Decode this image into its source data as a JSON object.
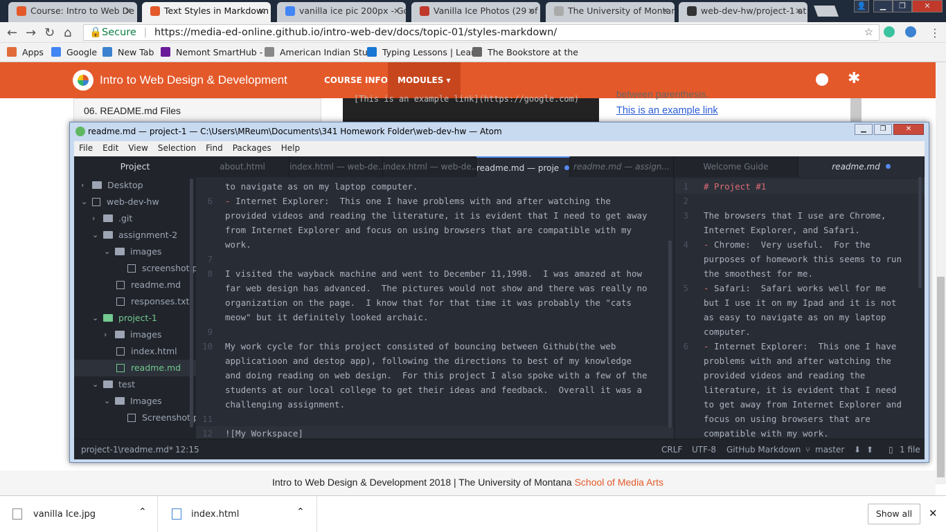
{
  "browser": {
    "tabs": [
      {
        "label": "Course: Intro to Web De",
        "fav": "#e4592a"
      },
      {
        "label": "Text Styles in Markdown",
        "fav": "#e4592a"
      },
      {
        "label": "vanilla ice pic 200px - Go",
        "fav": "#4285f4"
      },
      {
        "label": "Vanilla Ice Photos (29 of",
        "fav": "#c0392b"
      },
      {
        "label": "The University of Montar",
        "fav": "#aaa"
      },
      {
        "label": "web-dev-hw/project-1 at",
        "fav": "#333"
      }
    ],
    "secure": "Secure",
    "url": "https://media-ed-online.github.io/intro-web-dev/docs/topic-01/styles-markdown/",
    "bookmarks": [
      "Apps",
      "Google",
      "New Tab",
      "Nemont SmartHub -",
      "American Indian Stuc",
      "Typing Lessons | Lear",
      "The Bookstore at the"
    ]
  },
  "site": {
    "title": "Intro to Web Design & Development",
    "nav": [
      "COURSE INFO",
      "MODULES ▾"
    ],
    "side_item": "06. README.md Files",
    "code_sample": "[This is an example link](https://google.com)",
    "right_text": "between parenthesis.",
    "right_link": "This is an example link",
    "footer": "Intro to Web Design & Development 2018 | The University of Montana ",
    "footer_link": "School of Media Arts",
    "accent": "#e4592a"
  },
  "atom": {
    "title": "readme.md — project-1 — C:\\Users\\MReum\\Documents\\341 Homework Folder\\web-dev-hw — Atom",
    "menu": [
      "File",
      "Edit",
      "View",
      "Selection",
      "Find",
      "Packages",
      "Help"
    ],
    "project_label": "Project",
    "tree": [
      {
        "label": "Desktop",
        "type": "folder",
        "depth": 0,
        "arrow": "›"
      },
      {
        "label": "web-dev-hw",
        "type": "repo",
        "depth": 0,
        "arrow": "⌄"
      },
      {
        "label": ".git",
        "type": "folder",
        "depth": 1,
        "arrow": "›"
      },
      {
        "label": "assignment-2",
        "type": "folder",
        "depth": 1,
        "arrow": "⌄"
      },
      {
        "label": "images",
        "type": "folder",
        "depth": 2,
        "arrow": "⌄"
      },
      {
        "label": "screenshot.pr",
        "type": "image",
        "depth": 3,
        "arrow": ""
      },
      {
        "label": "readme.md",
        "type": "md",
        "depth": 2,
        "arrow": ""
      },
      {
        "label": "responses.txt",
        "type": "file",
        "depth": 2,
        "arrow": ""
      },
      {
        "label": "project-1",
        "type": "gfolder",
        "depth": 1,
        "arrow": "⌄"
      },
      {
        "label": "images",
        "type": "folder",
        "depth": 2,
        "arrow": "›"
      },
      {
        "label": "index.html",
        "type": "file",
        "depth": 2,
        "arrow": ""
      },
      {
        "label": "readme.md",
        "type": "gmd",
        "depth": 2,
        "arrow": ""
      },
      {
        "label": "test",
        "type": "folder",
        "depth": 1,
        "arrow": "⌄"
      },
      {
        "label": "Images",
        "type": "folder",
        "depth": 2,
        "arrow": "⌄"
      },
      {
        "label": "Screenshot.pr",
        "type": "image",
        "depth": 3,
        "arrow": ""
      }
    ],
    "tabs": [
      "about.html",
      "index.html — web-de...",
      "index.html — web-de...",
      "readme.md — proje",
      "readme.md — assign...",
      "Welcome Guide",
      "readme.md"
    ],
    "left_lines": [
      {
        "n": "",
        "t": "to navigate as on my laptop computer."
      },
      {
        "n": "6",
        "t": "- Internet Explorer:  This one I have problems with and after watching the"
      },
      {
        "n": "",
        "t": "provided videos and reading the literature, it is evident that I need to get away"
      },
      {
        "n": "",
        "t": "from Internet Explorer and focus on using browsers that are compatible with my"
      },
      {
        "n": "",
        "t": "work."
      },
      {
        "n": "7",
        "t": ""
      },
      {
        "n": "8",
        "t": "I visited the wayback machine and went to December 11,1998.  I was amazed at how"
      },
      {
        "n": "",
        "t": "far web design has advanced.  The pictures would not show and there was really no"
      },
      {
        "n": "",
        "t": "organization on the page.  I know that for that time it was probably the \"cats"
      },
      {
        "n": "",
        "t": "meow\" but it definitely looked archaic."
      },
      {
        "n": "9",
        "t": ""
      },
      {
        "n": "10",
        "t": "My work cycle for this project consisted of bouncing between Github(the web"
      },
      {
        "n": "",
        "t": "applicatioon and destop app), following the directions to best of my knowledge"
      },
      {
        "n": "",
        "t": "and doing reading on web design.  For this project I also spoke with a few of the"
      },
      {
        "n": "",
        "t": "students at our local college to get their ideas and feedback.  Overall it was a"
      },
      {
        "n": "",
        "t": "challenging assignment."
      },
      {
        "n": "11",
        "t": ""
      },
      {
        "n": "12",
        "t": "![My Workspace]"
      }
    ],
    "right_lines": [
      {
        "n": "1",
        "t": "# Project #1"
      },
      {
        "n": "2",
        "t": ""
      },
      {
        "n": "3",
        "t": "The browsers that I use are Chrome,"
      },
      {
        "n": "",
        "t": "Internet Explorer, and Safari."
      },
      {
        "n": "4",
        "t": "- Chrome:  Very useful.  For the"
      },
      {
        "n": "",
        "t": "purposes of homework this seems to run"
      },
      {
        "n": "",
        "t": "the smoothest for me."
      },
      {
        "n": "5",
        "t": "- Safari:  Safari works well for me"
      },
      {
        "n": "",
        "t": "but I use it on my Ipad and it is not"
      },
      {
        "n": "",
        "t": "as easy to navigate as on my laptop"
      },
      {
        "n": "",
        "t": "computer."
      },
      {
        "n": "6",
        "t": "- Internet Explorer:  This one I have"
      },
      {
        "n": "",
        "t": "problems with and after watching the"
      },
      {
        "n": "",
        "t": "provided videos and reading the"
      },
      {
        "n": "",
        "t": "literature, it is evident that I need"
      },
      {
        "n": "",
        "t": "to get away from Internet Explorer and"
      },
      {
        "n": "",
        "t": "focus on using browsers that are"
      },
      {
        "n": "",
        "t": "compatible with my work."
      }
    ],
    "status": {
      "path": "project-1\\readme.md*",
      "cursor": "12:15",
      "eol": "CRLF",
      "enc": "UTF-8",
      "grammar": "GitHub Markdown",
      "branch": "master",
      "files": "1 file"
    }
  },
  "downloads": {
    "items": [
      "vanilla Ice.jpg",
      "index.html"
    ],
    "show_all": "Show all"
  }
}
